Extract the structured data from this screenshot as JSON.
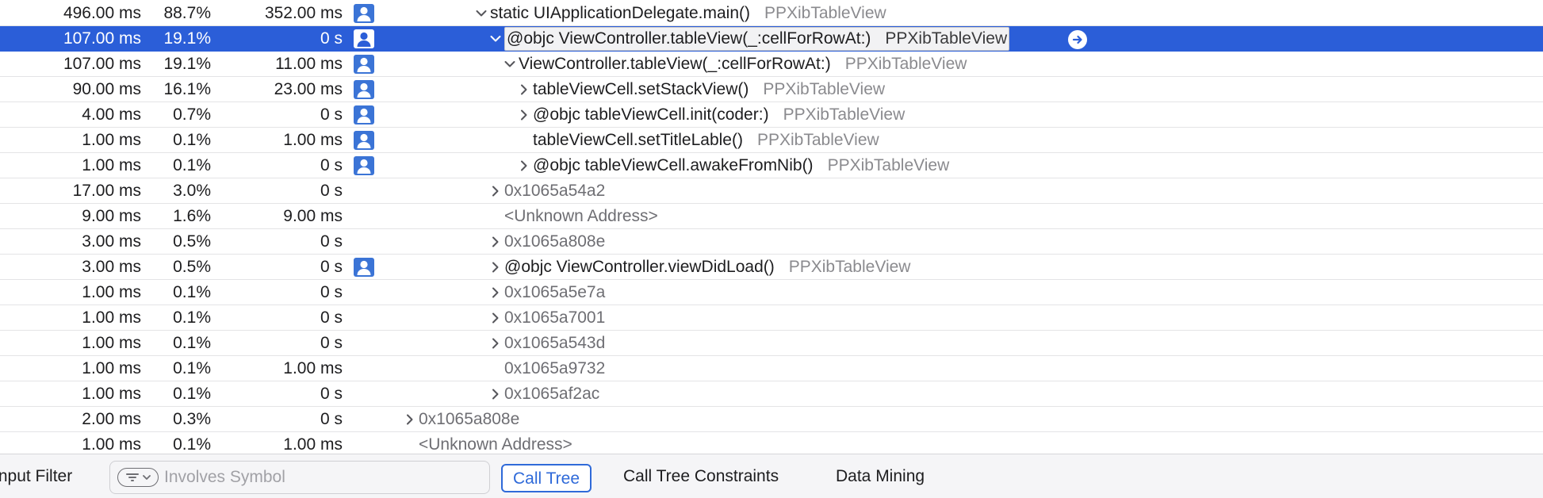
{
  "colors": {
    "selection": "#2b5ed8",
    "user_icon": "#3b74d6",
    "accent": "#2f6ad9",
    "secondary_text": "#8a8a8e"
  },
  "rows": [
    {
      "weight": "496.00 ms",
      "pct": "88.7%",
      "self": "352.00 ms",
      "user_icon": true,
      "expander": "expanded",
      "symbol": "static UIApplicationDelegate.main()",
      "library": "PPXibTableView",
      "selected": false
    },
    {
      "weight": "107.00 ms",
      "pct": "19.1%",
      "self": "0 s",
      "user_icon": true,
      "expander": "expanded",
      "symbol": "@objc ViewController.tableView(_:cellForRowAt:)",
      "library": "PPXibTableView",
      "selected": true
    },
    {
      "weight": "107.00 ms",
      "pct": "19.1%",
      "self": "11.00 ms",
      "user_icon": true,
      "expander": "expanded",
      "symbol": "ViewController.tableView(_:cellForRowAt:)",
      "library": "PPXibTableView",
      "selected": false
    },
    {
      "weight": "90.00 ms",
      "pct": "16.1%",
      "self": "23.00 ms",
      "user_icon": true,
      "expander": "collapsed",
      "symbol": "tableViewCell.setStackView()",
      "library": "PPXibTableView",
      "selected": false
    },
    {
      "weight": "4.00 ms",
      "pct": "0.7%",
      "self": "0 s",
      "user_icon": true,
      "expander": "collapsed",
      "symbol": "@objc tableViewCell.init(coder:)",
      "library": "PPXibTableView",
      "selected": false
    },
    {
      "weight": "1.00 ms",
      "pct": "0.1%",
      "self": "1.00 ms",
      "user_icon": true,
      "expander": "none",
      "symbol": "tableViewCell.setTitleLable()",
      "library": "PPXibTableView",
      "selected": false
    },
    {
      "weight": "1.00 ms",
      "pct": "0.1%",
      "self": "0 s",
      "user_icon": true,
      "expander": "collapsed",
      "symbol": "@objc tableViewCell.awakeFromNib()",
      "library": "PPXibTableView",
      "selected": false
    },
    {
      "weight": "17.00 ms",
      "pct": "3.0%",
      "self": "0 s",
      "user_icon": false,
      "expander": "collapsed",
      "symbol": "0x1065a54a2",
      "library": "",
      "selected": false
    },
    {
      "weight": "9.00 ms",
      "pct": "1.6%",
      "self": "9.00 ms",
      "user_icon": false,
      "expander": "none",
      "symbol": "<Unknown Address>",
      "library": "",
      "selected": false
    },
    {
      "weight": "3.00 ms",
      "pct": "0.5%",
      "self": "0 s",
      "user_icon": false,
      "expander": "collapsed",
      "symbol": "0x1065a808e",
      "library": "",
      "selected": false
    },
    {
      "weight": "3.00 ms",
      "pct": "0.5%",
      "self": "0 s",
      "user_icon": true,
      "expander": "collapsed",
      "symbol": "@objc ViewController.viewDidLoad()",
      "library": "PPXibTableView",
      "selected": false
    },
    {
      "weight": "1.00 ms",
      "pct": "0.1%",
      "self": "0 s",
      "user_icon": false,
      "expander": "collapsed",
      "symbol": "0x1065a5e7a",
      "library": "",
      "selected": false
    },
    {
      "weight": "1.00 ms",
      "pct": "0.1%",
      "self": "0 s",
      "user_icon": false,
      "expander": "collapsed",
      "symbol": "0x1065a7001",
      "library": "",
      "selected": false
    },
    {
      "weight": "1.00 ms",
      "pct": "0.1%",
      "self": "0 s",
      "user_icon": false,
      "expander": "collapsed",
      "symbol": "0x1065a543d",
      "library": "",
      "selected": false
    },
    {
      "weight": "1.00 ms",
      "pct": "0.1%",
      "self": "1.00 ms",
      "user_icon": false,
      "expander": "none",
      "symbol": "0x1065a9732",
      "library": "",
      "selected": false
    },
    {
      "weight": "1.00 ms",
      "pct": "0.1%",
      "self": "0 s",
      "user_icon": false,
      "expander": "collapsed",
      "symbol": "0x1065af2ac",
      "library": "",
      "selected": false
    },
    {
      "weight": "2.00 ms",
      "pct": "0.3%",
      "self": "0 s",
      "user_icon": false,
      "expander": "collapsed",
      "symbol": "0x1065a808e",
      "library": "",
      "selected": false
    },
    {
      "weight": "1.00 ms",
      "pct": "0.1%",
      "self": "1.00 ms",
      "user_icon": false,
      "expander": "none",
      "symbol": "<Unknown Address>",
      "library": "",
      "selected": false
    }
  ],
  "footer": {
    "filter_label": "Input Filter",
    "filter_placeholder": "Involves Symbol",
    "tabs": [
      {
        "label": "Call Tree",
        "active": true
      },
      {
        "label": "Call Tree Constraints",
        "active": false
      },
      {
        "label": "Data Mining",
        "active": false
      }
    ]
  }
}
